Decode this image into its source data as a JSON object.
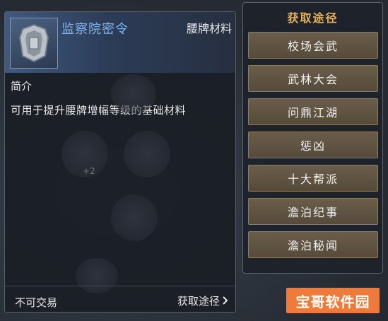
{
  "item": {
    "name": "监察院密令",
    "category": "腰牌材料",
    "section_label": "简介",
    "description": "可用于提升腰牌增幅等级的基础材料",
    "trade_status": "不可交易",
    "acquire_link": "获取途径",
    "ghost_plus": "+2"
  },
  "acquire_panel": {
    "title": "获取途径",
    "sources": [
      "校场会武",
      "武林大会",
      "问鼎江湖",
      "惩凶",
      "十大帮派",
      "澹泊纪事",
      "澹泊秘闻"
    ]
  },
  "watermark": "宝哥软件园",
  "colors": {
    "item_name": "#7fb4f0",
    "acquire_title": "#e6b25a",
    "source_button": "#5f5242",
    "watermark_bg": "#f07a3a"
  },
  "icons": {
    "item_icon": "silver-badge-icon",
    "acquire_arrow": "chevron-right-icon"
  }
}
